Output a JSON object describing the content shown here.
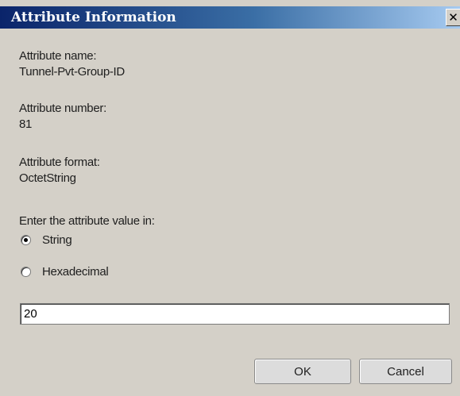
{
  "window": {
    "title": "Attribute Information",
    "close_symbol": "✕"
  },
  "attribute": {
    "name_label": "Attribute name:",
    "name_value": "Tunnel-Pvt-Group-ID",
    "number_label": "Attribute number:",
    "number_value": "81",
    "format_label": "Attribute format:",
    "format_value": "OctetString"
  },
  "value_mode": {
    "prompt": "Enter the attribute value in:",
    "options": [
      {
        "label": "String",
        "selected": true
      },
      {
        "label": "Hexadecimal",
        "selected": false
      }
    ]
  },
  "value_input": {
    "value": "20"
  },
  "buttons": {
    "ok_label": "OK",
    "cancel_label": "Cancel"
  },
  "colors": {
    "titlebar_start": "#0a246a",
    "titlebar_end": "#a6caf0",
    "dialog_background": "#d4d0c8"
  },
  "icons": {
    "close": "close-icon"
  }
}
